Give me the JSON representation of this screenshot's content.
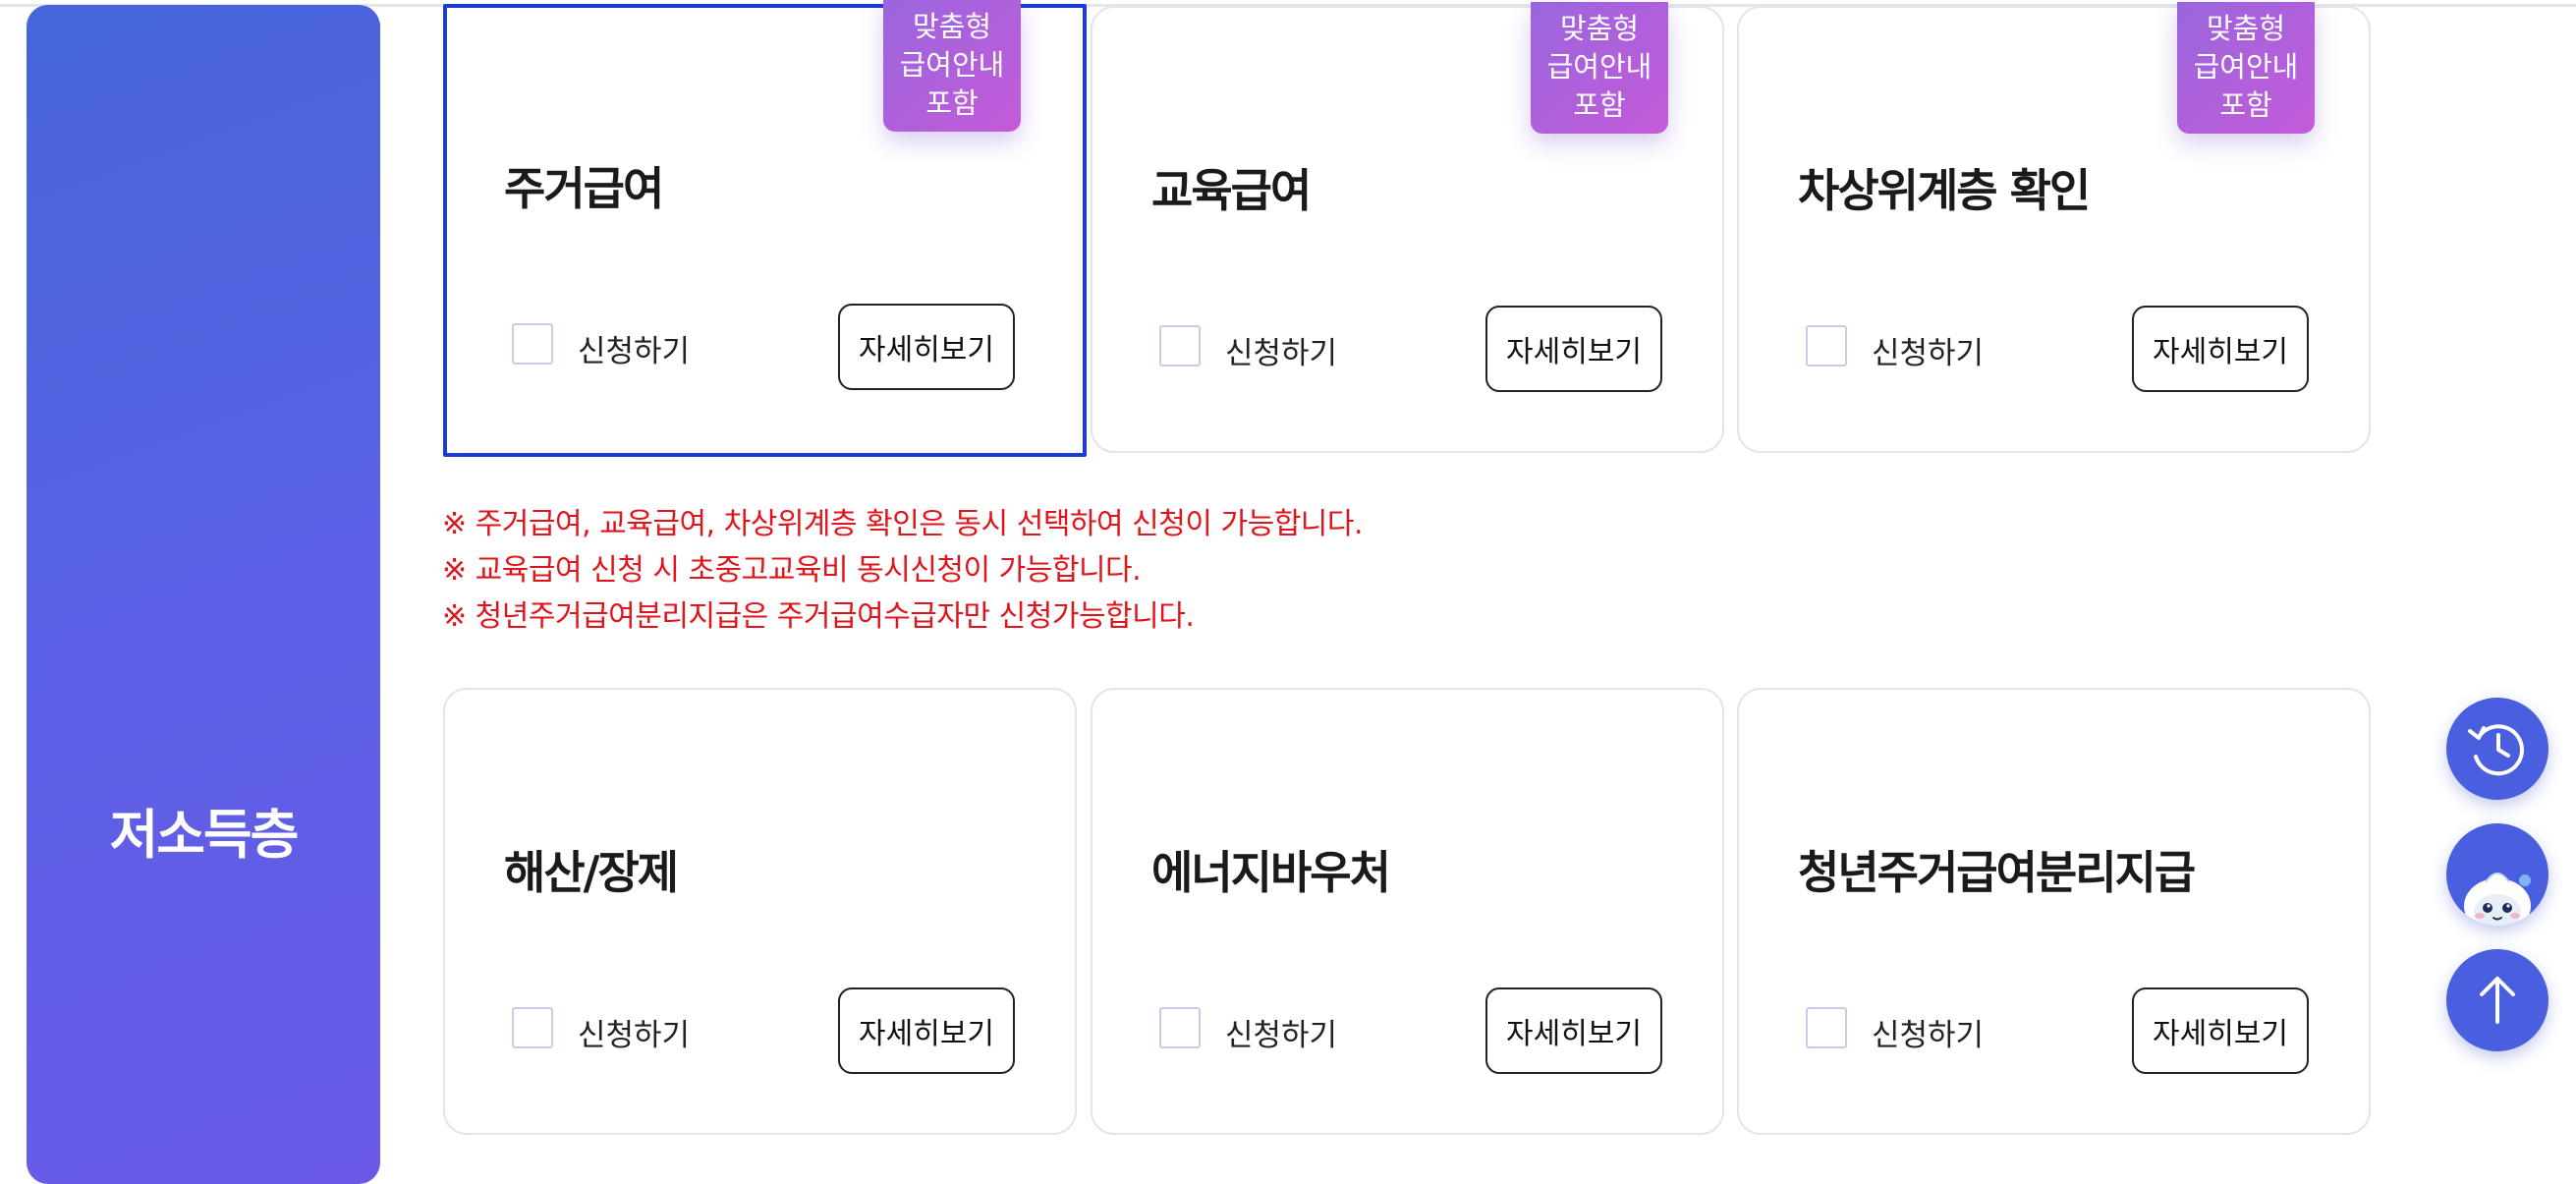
{
  "sidebar": {
    "title": "저소득층"
  },
  "badge_lines": [
    "맞춤형",
    "급여안내",
    "포함"
  ],
  "cards_row1": [
    {
      "title": "주거급여",
      "apply_label": "신청하기",
      "detail_label": "자세히보기",
      "badge": true
    },
    {
      "title": "교육급여",
      "apply_label": "신청하기",
      "detail_label": "자세히보기",
      "badge": true
    },
    {
      "title": "차상위계층 확인",
      "apply_label": "신청하기",
      "detail_label": "자세히보기",
      "badge": true
    }
  ],
  "notices": [
    "※ 주거급여, 교육급여, 차상위계층 확인은 동시 선택하여 신청이 가능합니다.",
    "※ 교육급여 신청 시 초중고교육비 동시신청이 가능합니다.",
    "※ 청년주거급여분리지급은 주거급여수급자만 신청가능합니다."
  ],
  "cards_row2": [
    {
      "title": "해산/장제",
      "apply_label": "신청하기",
      "detail_label": "자세히보기"
    },
    {
      "title": "에너지바우처",
      "apply_label": "신청하기",
      "detail_label": "자세히보기"
    },
    {
      "title": "청년주거급여분리지급",
      "apply_label": "신청하기",
      "detail_label": "자세히보기"
    }
  ],
  "floating": [
    "history-icon",
    "chatbot-mascot-icon",
    "arrow-up-icon"
  ],
  "colors": {
    "sidebar": "#5062e2",
    "badge": "#b45edb",
    "notice": "#e0151b",
    "selection": "#1a3bd6",
    "float": "#4a5ee0"
  }
}
